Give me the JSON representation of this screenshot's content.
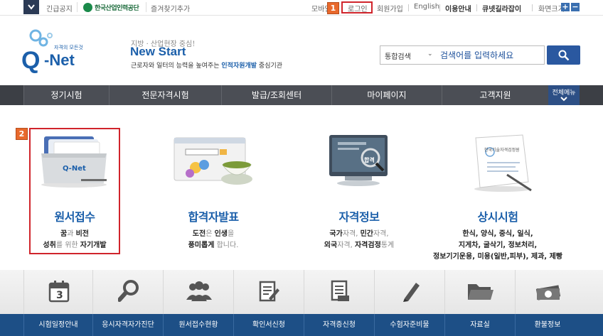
{
  "topbar": {
    "notice_label": "긴급공지",
    "org_name": "한국산업인력공단",
    "bookmark_label": "즐겨찾기추가",
    "mobile_label": "모바일",
    "login_label": "로그인",
    "signup_label": "회원가입",
    "english_label": "English",
    "guide_label": "이용안내",
    "qnet_guide_label": "큐넷길라잡이",
    "zoom_label": "화면크기",
    "zoom_in": "+",
    "zoom_out": "−"
  },
  "badges": {
    "login_badge": "1",
    "apply_badge": "2"
  },
  "header": {
    "logo_sub": "자격의 모든것",
    "logo_q": "Q",
    "logo_net": "-Net",
    "slogan_small": "지방 · 산업현장 중심!",
    "slogan_big": "New Start",
    "slogan_line_prefix": "근로자와 일터의 능력을 높여주는 ",
    "slogan_line_highlight": "인적자원개발",
    "slogan_line_suffix": " 중심기관"
  },
  "search": {
    "category": "통합검색",
    "placeholder": "검색어를 입력하세요"
  },
  "nav": {
    "items": [
      "정기시험",
      "전문자격시험",
      "발급/조회센터",
      "마이페이지",
      "고객지원"
    ],
    "all_menu_label": "전체메뉴"
  },
  "services": [
    {
      "title": "원서접수",
      "line1_a": "꿈",
      "line1_b": "과 ",
      "line1_c": "비전",
      "line2_a": "성취",
      "line2_b": "를 위한 ",
      "line2_c": "자기개발"
    },
    {
      "title": "합격자발표",
      "line1_a": "도전",
      "line1_b": "은 ",
      "line1_c": "인생",
      "line1_d": "을",
      "line2_a": "풍미롭게",
      "line2_b": " 합니다."
    },
    {
      "title": "자격정보",
      "line1_a": "국가",
      "line1_b": "자격, ",
      "line1_c": "민간",
      "line1_d": "자격,",
      "line2_a": "외국",
      "line2_b": "자격, ",
      "line2_c": "자격검정",
      "line2_d": "통계"
    },
    {
      "title": "상시시험",
      "line1": "한식, 양식, 중식, 일식,",
      "line2": "지게차, 굴삭기, 정보처리,",
      "line3": "정보기기운용, 미용(일반,피부), 제과, 제빵"
    }
  ],
  "illustrations": {
    "folder_text": "Q-Net",
    "monitor_text": "합격",
    "certificate_text": "한국기술자격검정원"
  },
  "calendar_day": "3",
  "bottom_nav": [
    "시험일정안내",
    "응시자격자가진단",
    "원서접수현황",
    "확인서신청",
    "자격증신청",
    "수험자준비물",
    "자료실",
    "환불정보"
  ],
  "colors": {
    "brand_blue": "#1b5faa",
    "nav_gray": "#4b4e55",
    "bottom_blue": "#1d4f86",
    "highlight_red": "#d0242b",
    "badge_orange": "#e8692c"
  }
}
